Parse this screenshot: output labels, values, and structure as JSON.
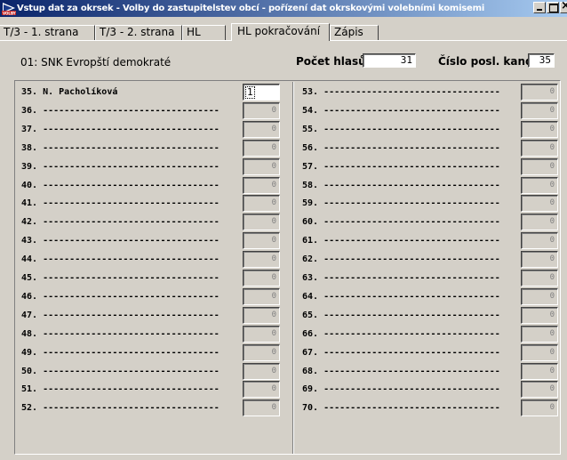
{
  "window": {
    "title": "Vstup dat za okrsek - Volby do zastupitelstev obcí - pořízení dat okrskovými volebními komisemi"
  },
  "tabs": [
    {
      "label": "T/3 - 1. strana",
      "active": false
    },
    {
      "label": "T/3 - 2. strana",
      "active": false
    },
    {
      "label": "HL",
      "active": false
    },
    {
      "label": "HL pokračování",
      "active": true
    },
    {
      "label": "Zápis",
      "active": false
    }
  ],
  "header": {
    "party": "01: SNK Evropští demokraté",
    "votes_label": "Počet hlasů",
    "votes_value": "31",
    "cand_label": "Číslo posl. kand.",
    "cand_value": "35"
  },
  "candidates_left": [
    {
      "label": "35. N. Pacholíková",
      "value": "1"
    },
    {
      "label": "36. ---------------------------------",
      "value": "0"
    },
    {
      "label": "37. ---------------------------------",
      "value": "0"
    },
    {
      "label": "38. ---------------------------------",
      "value": "0"
    },
    {
      "label": "39. ---------------------------------",
      "value": "0"
    },
    {
      "label": "40. ---------------------------------",
      "value": "0"
    },
    {
      "label": "41. ---------------------------------",
      "value": "0"
    },
    {
      "label": "42. ---------------------------------",
      "value": "0"
    },
    {
      "label": "43. ---------------------------------",
      "value": "0"
    },
    {
      "label": "44. ---------------------------------",
      "value": "0"
    },
    {
      "label": "45. ---------------------------------",
      "value": "0"
    },
    {
      "label": "46. ---------------------------------",
      "value": "0"
    },
    {
      "label": "47. ---------------------------------",
      "value": "0"
    },
    {
      "label": "48. ---------------------------------",
      "value": "0"
    },
    {
      "label": "49. ---------------------------------",
      "value": "0"
    },
    {
      "label": "50. ---------------------------------",
      "value": "0"
    },
    {
      "label": "51. ---------------------------------",
      "value": "0"
    },
    {
      "label": "52. ---------------------------------",
      "value": "0"
    }
  ],
  "candidates_right": [
    {
      "label": "53. ---------------------------------",
      "value": "0"
    },
    {
      "label": "54. ---------------------------------",
      "value": "0"
    },
    {
      "label": "55. ---------------------------------",
      "value": "0"
    },
    {
      "label": "56. ---------------------------------",
      "value": "0"
    },
    {
      "label": "57. ---------------------------------",
      "value": "0"
    },
    {
      "label": "58. ---------------------------------",
      "value": "0"
    },
    {
      "label": "59. ---------------------------------",
      "value": "0"
    },
    {
      "label": "60. ---------------------------------",
      "value": "0"
    },
    {
      "label": "61. ---------------------------------",
      "value": "0"
    },
    {
      "label": "62. ---------------------------------",
      "value": "0"
    },
    {
      "label": "63. ---------------------------------",
      "value": "0"
    },
    {
      "label": "64. ---------------------------------",
      "value": "0"
    },
    {
      "label": "65. ---------------------------------",
      "value": "0"
    },
    {
      "label": "66. ---------------------------------",
      "value": "0"
    },
    {
      "label": "67. ---------------------------------",
      "value": "0"
    },
    {
      "label": "68. ---------------------------------",
      "value": "0"
    },
    {
      "label": "69. ---------------------------------",
      "value": "0"
    },
    {
      "label": "70. ---------------------------------",
      "value": "0"
    }
  ]
}
